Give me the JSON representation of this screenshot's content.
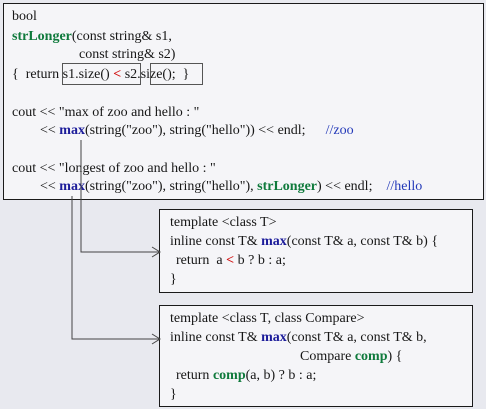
{
  "main": {
    "l1": "bool",
    "l2_fn": "strLonger",
    "l2_rest": "(const string& s1,",
    "l3": "const string& s2)",
    "l4_a": "{  return ",
    "l4_b": "s1.size()",
    "l4_lt": " < ",
    "l4_c": "s2.size();",
    "l4_d": "  }",
    "l6": "cout << \"max of zoo and hello : \"",
    "l7_a": "<< ",
    "l7_max": "max",
    "l7_b": "(string(\"zoo\"), string(\"hello\")) << endl;",
    "l7_comment": "//zoo",
    "l9": "cout << \"longest of zoo and hello : \"",
    "l10_a": "<< ",
    "l10_max": "max",
    "l10_b": "(string(\"zoo\"), string(\"hello\"), ",
    "l10_fn": "strLonger",
    "l10_c": ") << endl;",
    "l10_comment": "//hello"
  },
  "template1": {
    "l1": "template <class T>",
    "l2_a": "inline const T& ",
    "l2_max": "max",
    "l2_b": "(const T& a, const T& b) {",
    "l3_a": "return  a ",
    "l3_lt": "<",
    "l3_b": " b ? b : a;",
    "l4": "}"
  },
  "template2": {
    "l1": "template <class T, class Compare>",
    "l2_a": "inline const T& ",
    "l2_max": "max",
    "l2_b": "(const T& a, const T& b,",
    "l3_a": "Compare ",
    "l3_comp": "comp",
    "l3_b": ") {",
    "l4_a": "return ",
    "l4_comp": "comp",
    "l4_b": "(a, b) ? b : a;",
    "l5": "}"
  },
  "colors": {
    "function_name": "#0f7a3c",
    "max_keyword": "#1c1c9a",
    "less_than": "#d11010",
    "comment": "#2238b8"
  }
}
